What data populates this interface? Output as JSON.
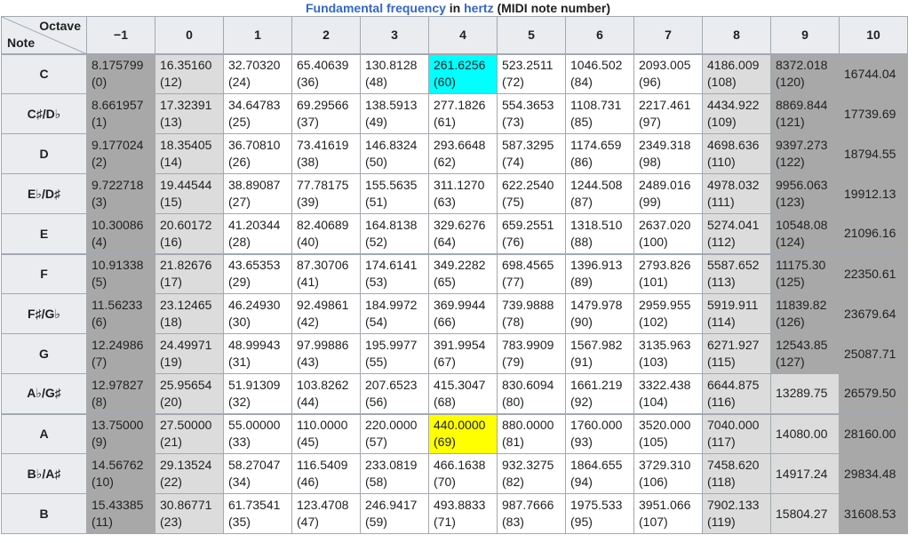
{
  "caption": {
    "link_text": "Fundamental frequency",
    "mid_text": " in ",
    "unit_link": "hertz",
    "suffix": " (MIDI note number)"
  },
  "corner": {
    "column_axis": "Octave",
    "row_axis": "Note"
  },
  "octaves": [
    "−1",
    "0",
    "1",
    "2",
    "3",
    "4",
    "5",
    "6",
    "7",
    "8",
    "9",
    "10"
  ],
  "colors": {
    "dark": "#a8a8a8",
    "light": "#dcdcdc",
    "middle_c": "#00ffff",
    "a440": "#ffff00",
    "header": "#eaecf0"
  },
  "rows": [
    {
      "note": "C",
      "cells": [
        {
          "f": "8.175799",
          "m": "(0)"
        },
        {
          "f": "16.35160",
          "m": "(12)"
        },
        {
          "f": "32.70320",
          "m": "(24)"
        },
        {
          "f": "65.40639",
          "m": "(36)"
        },
        {
          "f": "130.8128",
          "m": "(48)"
        },
        {
          "f": "261.6256",
          "m": "(60)"
        },
        {
          "f": "523.2511",
          "m": "(72)"
        },
        {
          "f": "1046.502",
          "m": "(84)"
        },
        {
          "f": "2093.005",
          "m": "(96)"
        },
        {
          "f": "4186.009",
          "m": "(108)"
        },
        {
          "f": "8372.018",
          "m": "(120)"
        },
        {
          "f": "16744.04",
          "m": ""
        }
      ]
    },
    {
      "note": "C♯/D♭",
      "cells": [
        {
          "f": "8.661957",
          "m": "(1)"
        },
        {
          "f": "17.32391",
          "m": "(13)"
        },
        {
          "f": "34.64783",
          "m": "(25)"
        },
        {
          "f": "69.29566",
          "m": "(37)"
        },
        {
          "f": "138.5913",
          "m": "(49)"
        },
        {
          "f": "277.1826",
          "m": "(61)"
        },
        {
          "f": "554.3653",
          "m": "(73)"
        },
        {
          "f": "1108.731",
          "m": "(85)"
        },
        {
          "f": "2217.461",
          "m": "(97)"
        },
        {
          "f": "4434.922",
          "m": "(109)"
        },
        {
          "f": "8869.844",
          "m": "(121)"
        },
        {
          "f": "17739.69",
          "m": ""
        }
      ]
    },
    {
      "note": "D",
      "cells": [
        {
          "f": "9.177024",
          "m": "(2)"
        },
        {
          "f": "18.35405",
          "m": "(14)"
        },
        {
          "f": "36.70810",
          "m": "(26)"
        },
        {
          "f": "73.41619",
          "m": "(38)"
        },
        {
          "f": "146.8324",
          "m": "(50)"
        },
        {
          "f": "293.6648",
          "m": "(62)"
        },
        {
          "f": "587.3295",
          "m": "(74)"
        },
        {
          "f": "1174.659",
          "m": "(86)"
        },
        {
          "f": "2349.318",
          "m": "(98)"
        },
        {
          "f": "4698.636",
          "m": "(110)"
        },
        {
          "f": "9397.273",
          "m": "(122)"
        },
        {
          "f": "18794.55",
          "m": ""
        }
      ]
    },
    {
      "note": "E♭/D♯",
      "cells": [
        {
          "f": "9.722718",
          "m": "(3)"
        },
        {
          "f": "19.44544",
          "m": "(15)"
        },
        {
          "f": "38.89087",
          "m": "(27)"
        },
        {
          "f": "77.78175",
          "m": "(39)"
        },
        {
          "f": "155.5635",
          "m": "(51)"
        },
        {
          "f": "311.1270",
          "m": "(63)"
        },
        {
          "f": "622.2540",
          "m": "(75)"
        },
        {
          "f": "1244.508",
          "m": "(87)"
        },
        {
          "f": "2489.016",
          "m": "(99)"
        },
        {
          "f": "4978.032",
          "m": "(111)"
        },
        {
          "f": "9956.063",
          "m": "(123)"
        },
        {
          "f": "19912.13",
          "m": ""
        }
      ]
    },
    {
      "note": "E",
      "cells": [
        {
          "f": "10.30086",
          "m": "(4)"
        },
        {
          "f": "20.60172",
          "m": "(16)"
        },
        {
          "f": "41.20344",
          "m": "(28)"
        },
        {
          "f": "82.40689",
          "m": "(40)"
        },
        {
          "f": "164.8138",
          "m": "(52)"
        },
        {
          "f": "329.6276",
          "m": "(64)"
        },
        {
          "f": "659.2551",
          "m": "(76)"
        },
        {
          "f": "1318.510",
          "m": "(88)"
        },
        {
          "f": "2637.020",
          "m": "(100)"
        },
        {
          "f": "5274.041",
          "m": "(112)"
        },
        {
          "f": "10548.08",
          "m": "(124)"
        },
        {
          "f": "21096.16",
          "m": ""
        }
      ]
    },
    {
      "note": "F",
      "cells": [
        {
          "f": "10.91338",
          "m": "(5)"
        },
        {
          "f": "21.82676",
          "m": "(17)"
        },
        {
          "f": "43.65353",
          "m": "(29)"
        },
        {
          "f": "87.30706",
          "m": "(41)"
        },
        {
          "f": "174.6141",
          "m": "(53)"
        },
        {
          "f": "349.2282",
          "m": "(65)"
        },
        {
          "f": "698.4565",
          "m": "(77)"
        },
        {
          "f": "1396.913",
          "m": "(89)"
        },
        {
          "f": "2793.826",
          "m": "(101)"
        },
        {
          "f": "5587.652",
          "m": "(113)"
        },
        {
          "f": "11175.30",
          "m": "(125)"
        },
        {
          "f": "22350.61",
          "m": ""
        }
      ]
    },
    {
      "note": "F♯/G♭",
      "cells": [
        {
          "f": "11.56233",
          "m": "(6)"
        },
        {
          "f": "23.12465",
          "m": "(18)"
        },
        {
          "f": "46.24930",
          "m": "(30)"
        },
        {
          "f": "92.49861",
          "m": "(42)"
        },
        {
          "f": "184.9972",
          "m": "(54)"
        },
        {
          "f": "369.9944",
          "m": "(66)"
        },
        {
          "f": "739.9888",
          "m": "(78)"
        },
        {
          "f": "1479.978",
          "m": "(90)"
        },
        {
          "f": "2959.955",
          "m": "(102)"
        },
        {
          "f": "5919.911",
          "m": "(114)"
        },
        {
          "f": "11839.82",
          "m": "(126)"
        },
        {
          "f": "23679.64",
          "m": ""
        }
      ]
    },
    {
      "note": "G",
      "cells": [
        {
          "f": "12.24986",
          "m": "(7)"
        },
        {
          "f": "24.49971",
          "m": "(19)"
        },
        {
          "f": "48.99943",
          "m": "(31)"
        },
        {
          "f": "97.99886",
          "m": "(43)"
        },
        {
          "f": "195.9977",
          "m": "(55)"
        },
        {
          "f": "391.9954",
          "m": "(67)"
        },
        {
          "f": "783.9909",
          "m": "(79)"
        },
        {
          "f": "1567.982",
          "m": "(91)"
        },
        {
          "f": "3135.963",
          "m": "(103)"
        },
        {
          "f": "6271.927",
          "m": "(115)"
        },
        {
          "f": "12543.85",
          "m": "(127)"
        },
        {
          "f": "25087.71",
          "m": ""
        }
      ]
    },
    {
      "note": "A♭/G♯",
      "cells": [
        {
          "f": "12.97827",
          "m": "(8)"
        },
        {
          "f": "25.95654",
          "m": "(20)"
        },
        {
          "f": "51.91309",
          "m": "(32)"
        },
        {
          "f": "103.8262",
          "m": "(44)"
        },
        {
          "f": "207.6523",
          "m": "(56)"
        },
        {
          "f": "415.3047",
          "m": "(68)"
        },
        {
          "f": "830.6094",
          "m": "(80)"
        },
        {
          "f": "1661.219",
          "m": "(92)"
        },
        {
          "f": "3322.438",
          "m": "(104)"
        },
        {
          "f": "6644.875",
          "m": "(116)"
        },
        {
          "f": "13289.75",
          "m": ""
        },
        {
          "f": "26579.50",
          "m": ""
        }
      ]
    },
    {
      "note": "A",
      "cells": [
        {
          "f": "13.75000",
          "m": "(9)"
        },
        {
          "f": "27.50000",
          "m": "(21)"
        },
        {
          "f": "55.00000",
          "m": "(33)"
        },
        {
          "f": "110.0000",
          "m": "(45)"
        },
        {
          "f": "220.0000",
          "m": "(57)"
        },
        {
          "f": "440.0000",
          "m": "(69)"
        },
        {
          "f": "880.0000",
          "m": "(81)"
        },
        {
          "f": "1760.000",
          "m": "(93)"
        },
        {
          "f": "3520.000",
          "m": "(105)"
        },
        {
          "f": "7040.000",
          "m": "(117)"
        },
        {
          "f": "14080.00",
          "m": ""
        },
        {
          "f": "28160.00",
          "m": ""
        }
      ]
    },
    {
      "note": "B♭/A♯",
      "cells": [
        {
          "f": "14.56762",
          "m": "(10)"
        },
        {
          "f": "29.13524",
          "m": "(22)"
        },
        {
          "f": "58.27047",
          "m": "(34)"
        },
        {
          "f": "116.5409",
          "m": "(46)"
        },
        {
          "f": "233.0819",
          "m": "(58)"
        },
        {
          "f": "466.1638",
          "m": "(70)"
        },
        {
          "f": "932.3275",
          "m": "(82)"
        },
        {
          "f": "1864.655",
          "m": "(94)"
        },
        {
          "f": "3729.310",
          "m": "(106)"
        },
        {
          "f": "7458.620",
          "m": "(118)"
        },
        {
          "f": "14917.24",
          "m": ""
        },
        {
          "f": "29834.48",
          "m": ""
        }
      ]
    },
    {
      "note": "B",
      "cells": [
        {
          "f": "15.43385",
          "m": "(11)"
        },
        {
          "f": "30.86771",
          "m": "(23)"
        },
        {
          "f": "61.73541",
          "m": "(35)"
        },
        {
          "f": "123.4708",
          "m": "(47)"
        },
        {
          "f": "246.9417",
          "m": "(59)"
        },
        {
          "f": "493.8833",
          "m": "(71)"
        },
        {
          "f": "987.7666",
          "m": "(83)"
        },
        {
          "f": "1975.533",
          "m": "(95)"
        },
        {
          "f": "3951.066",
          "m": "(107)"
        },
        {
          "f": "7902.133",
          "m": "(119)"
        },
        {
          "f": "15804.27",
          "m": ""
        },
        {
          "f": "31608.53",
          "m": ""
        }
      ]
    }
  ]
}
